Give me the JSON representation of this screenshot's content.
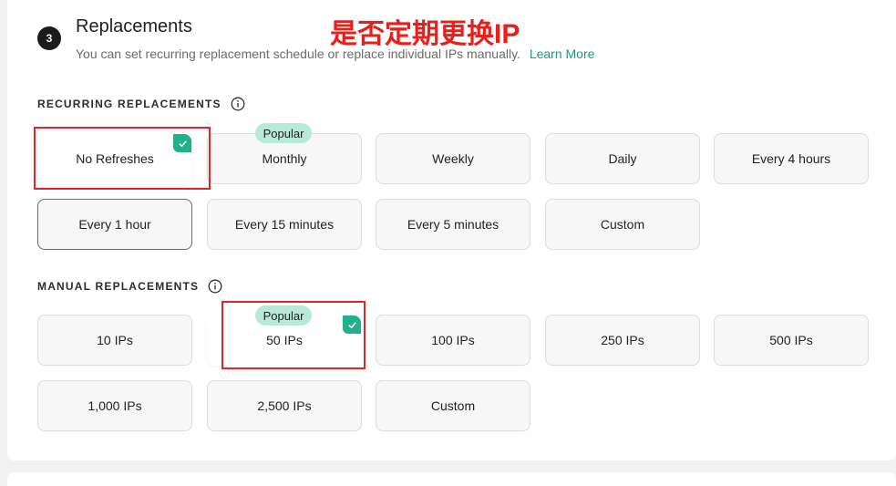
{
  "section": {
    "step": "3",
    "title": "Replacements",
    "description": "You can set recurring replacement schedule or replace individual IPs manually.",
    "learn_more": "Learn More",
    "annotation": "是否定期更换IP"
  },
  "recurring": {
    "label": "RECURRING REPLACEMENTS",
    "popular_badge": "Popular",
    "options": [
      "No Refreshes",
      "Monthly",
      "Weekly",
      "Daily",
      "Every 4 hours",
      "Every 1 hour",
      "Every 15 minutes",
      "Every 5 minutes",
      "Custom"
    ],
    "selected": "No Refreshes"
  },
  "manual": {
    "label": "MANUAL REPLACEMENTS",
    "popular_badge": "Popular",
    "options": [
      "10 IPs",
      "50 IPs",
      "100 IPs",
      "250 IPs",
      "500 IPs",
      "1,000 IPs",
      "2,500 IPs",
      "Custom"
    ],
    "selected": "50 IPs"
  },
  "colors": {
    "accent": "#22b08c",
    "link": "#1d9a80",
    "popular_bg": "#b8ead8",
    "annotation": "#e8201c"
  }
}
